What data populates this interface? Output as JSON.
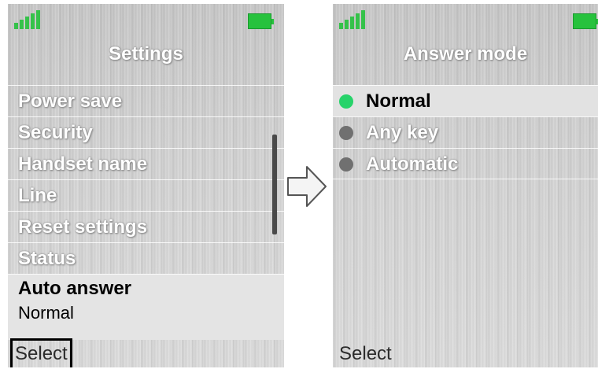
{
  "left_screen": {
    "title": "Settings",
    "menu_items": [
      {
        "label": "Power save"
      },
      {
        "label": "Security"
      },
      {
        "label": "Handset name"
      },
      {
        "label": "Line"
      },
      {
        "label": "Reset settings"
      },
      {
        "label": "Status"
      }
    ],
    "selected_item": {
      "label": "Auto answer",
      "value": "Normal"
    },
    "softkey": "Select"
  },
  "right_screen": {
    "title": "Answer mode",
    "options": [
      {
        "label": "Normal",
        "selected": true
      },
      {
        "label": "Any key",
        "selected": false
      },
      {
        "label": "Automatic",
        "selected": false
      }
    ],
    "softkey": "Select"
  },
  "colors": {
    "signal": "#35c24a",
    "battery": "#27c23d",
    "radio_selected": "#27d36a",
    "radio_unselected": "#707070"
  },
  "icons": [
    "signal-strength-icon",
    "battery-icon",
    "right-arrow-icon",
    "radio-dot-icon"
  ]
}
